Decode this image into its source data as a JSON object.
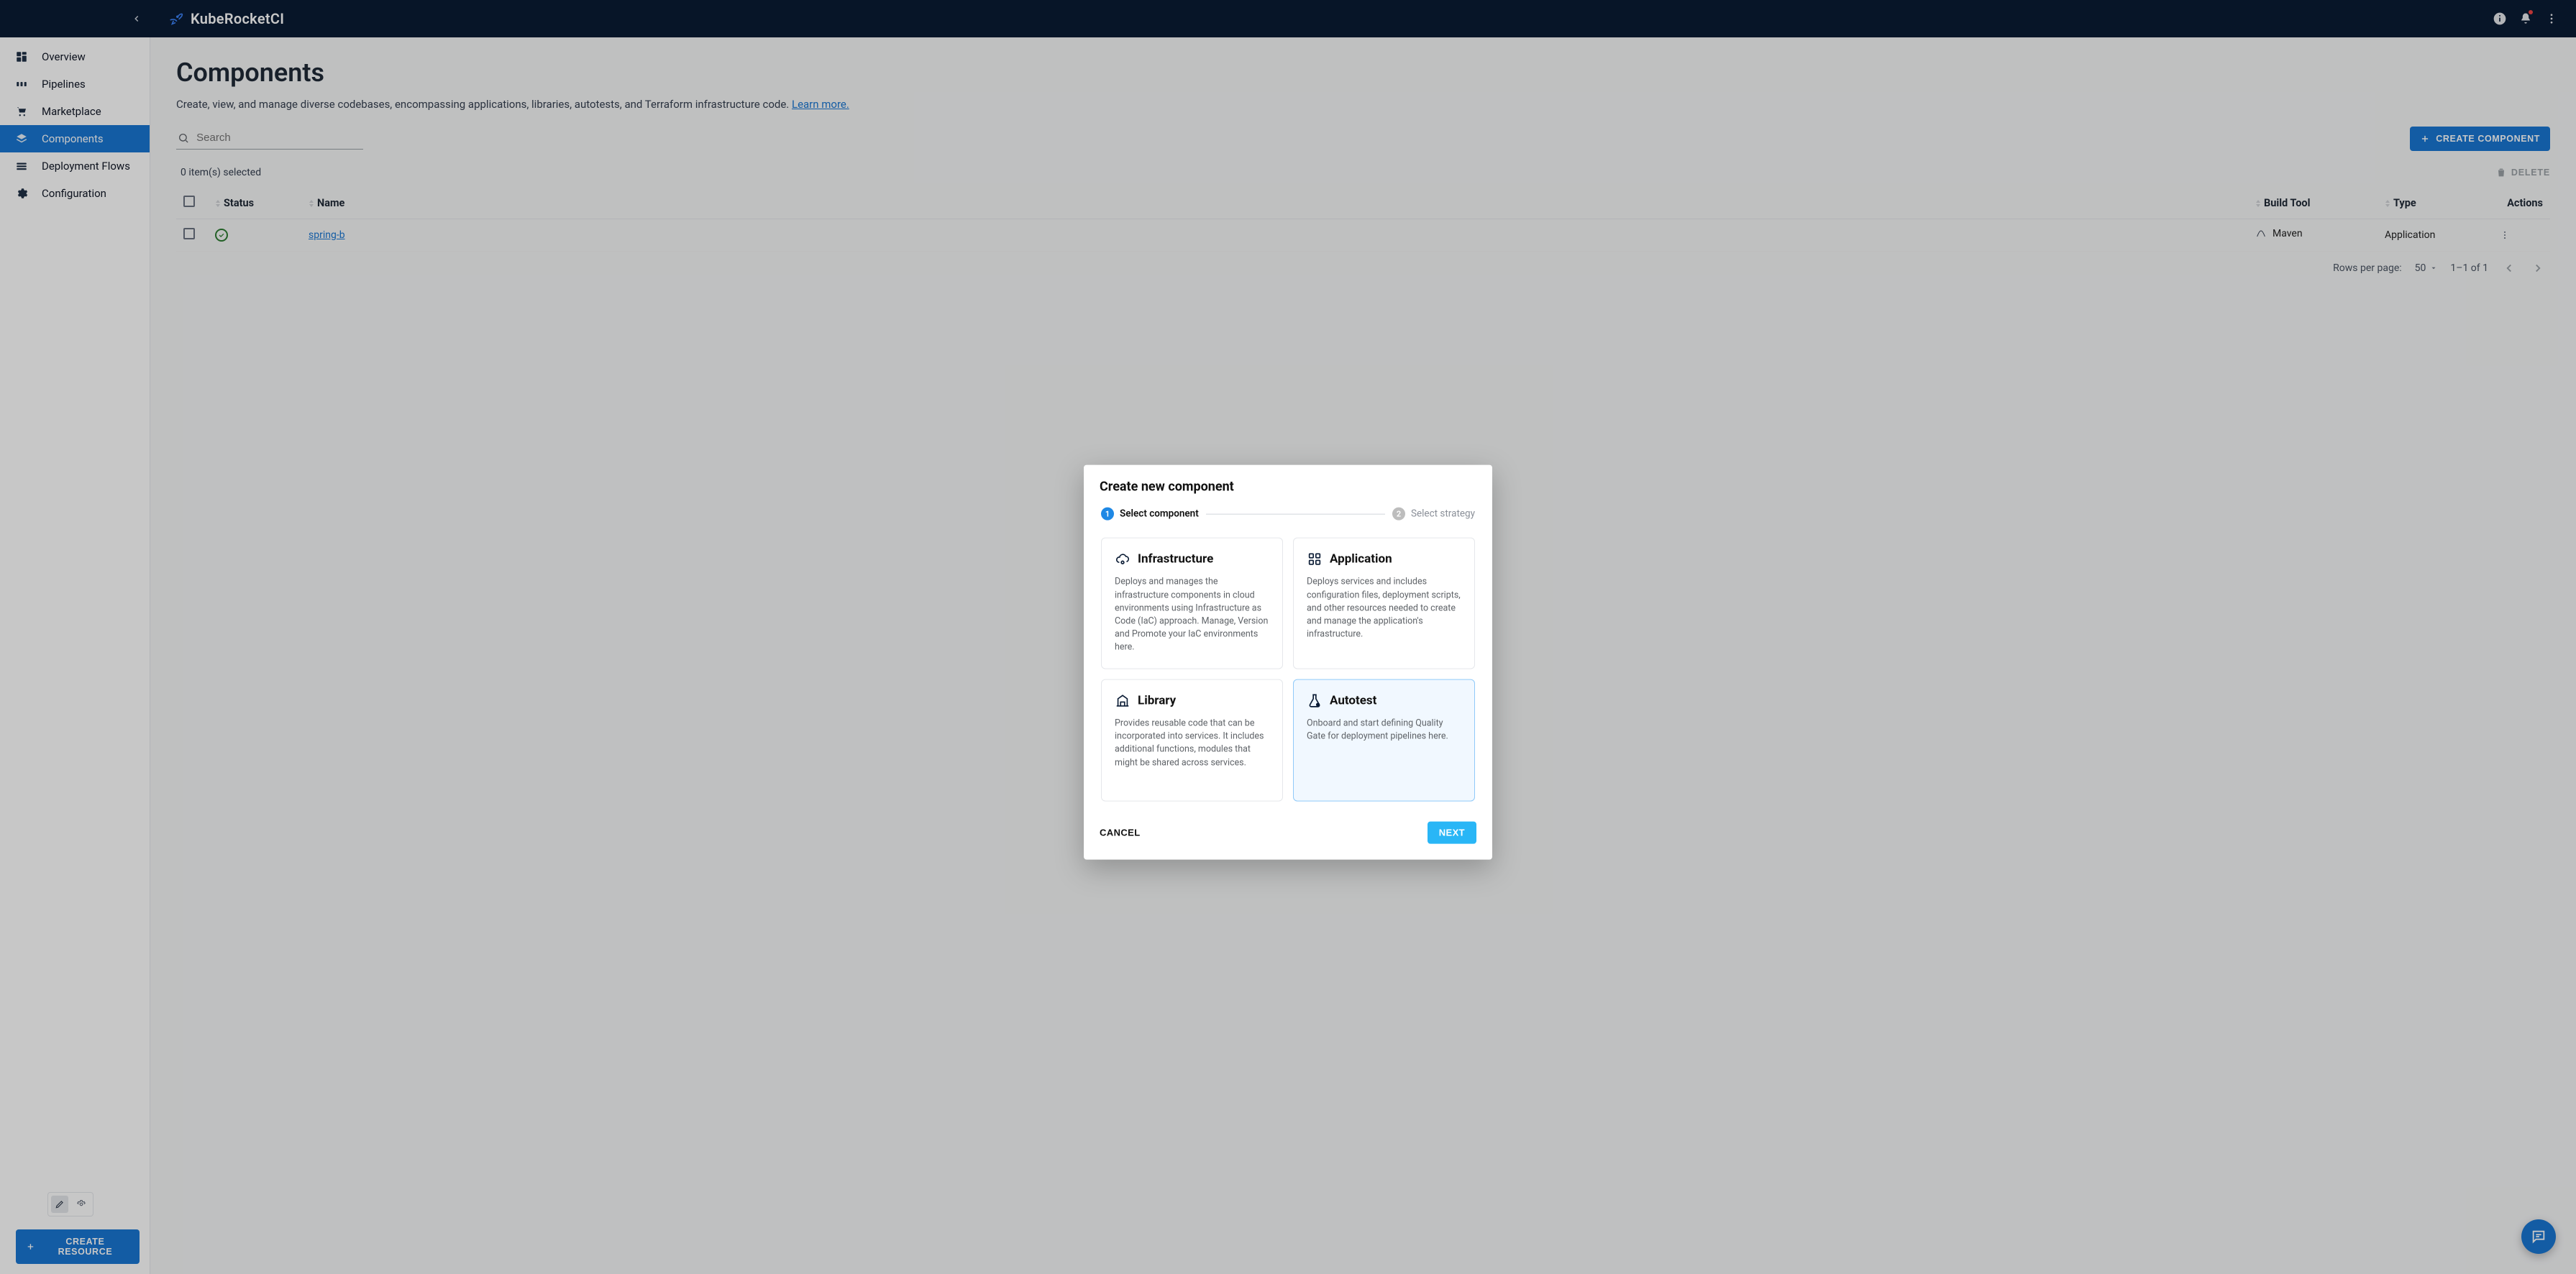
{
  "header": {
    "brand": "KubeRocketCI"
  },
  "sidebar": {
    "items": [
      {
        "label": "Overview"
      },
      {
        "label": "Pipelines"
      },
      {
        "label": "Marketplace"
      },
      {
        "label": "Components"
      },
      {
        "label": "Deployment Flows"
      },
      {
        "label": "Configuration"
      }
    ],
    "create_resource": "CREATE RESOURCE"
  },
  "page": {
    "title": "Components",
    "description_prefix": "Create, view, and manage diverse codebases, encompassing applications, libraries, autotests, and Terraform infrastructure code. ",
    "description_link": "Learn more."
  },
  "toolbar": {
    "search_placeholder": "Search",
    "create_component": "CREATE COMPONENT",
    "delete": "DELETE",
    "selected_text": "0 item(s) selected"
  },
  "table": {
    "columns": [
      "Status",
      "Name",
      "Build Tool",
      "Type",
      "Actions"
    ],
    "rows": [
      {
        "status": "ok",
        "name": "spring-b",
        "build_tool": "Maven",
        "type": "Application"
      }
    ]
  },
  "pager": {
    "rows_per_page_label": "Rows per page:",
    "rows_per_page_value": "50",
    "range": "1–1 of 1"
  },
  "modal": {
    "title": "Create new component",
    "steps": [
      {
        "num": "1",
        "label": "Select component"
      },
      {
        "num": "2",
        "label": "Select strategy"
      }
    ],
    "cards": [
      {
        "key": "infrastructure",
        "title": "Infrastructure",
        "desc": "Deploys and manages the infrastructure components in cloud environments using Infrastructure as Code (IaC) approach. Manage, Version and Promote your IaC environments here."
      },
      {
        "key": "application",
        "title": "Application",
        "desc": "Deploys services and includes configuration files, deployment scripts, and other resources needed to create and manage the application's infrastructure."
      },
      {
        "key": "library",
        "title": "Library",
        "desc": "Provides reusable code that can be incorporated into services. It includes additional functions, modules that might be shared across services."
      },
      {
        "key": "autotest",
        "title": "Autotest",
        "desc": "Onboard and start defining Quality Gate for deployment pipelines here."
      }
    ],
    "selected": "autotest",
    "cancel": "CANCEL",
    "next": "NEXT"
  }
}
